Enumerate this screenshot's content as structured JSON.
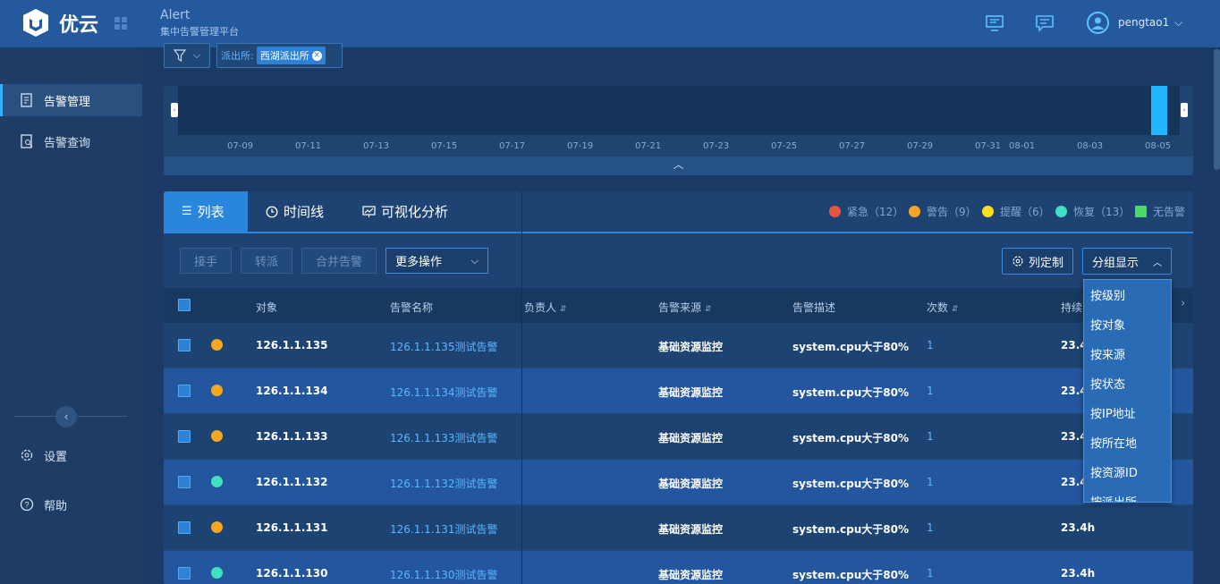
{
  "header": {
    "logo_text": "优云",
    "app_title": "Alert",
    "app_subtitle": "集中告警管理平台",
    "user_name": "pengtao1",
    "icons": [
      "monitor-icon",
      "message-icon",
      "user-icon",
      "chevron-down-icon"
    ]
  },
  "sidebar": {
    "items": [
      {
        "label": "告警管理",
        "icon": "alarm-list-icon",
        "active": true
      },
      {
        "label": "告警查询",
        "icon": "alarm-search-icon",
        "active": false
      }
    ],
    "settings_label": "设置",
    "help_label": "帮助"
  },
  "filter": {
    "key": "派出所:",
    "value": "西湖派出所"
  },
  "timeline": {
    "dates": [
      "07-09",
      "07-11",
      "07-13",
      "07-15",
      "07-17",
      "07-19",
      "07-21",
      "07-23",
      "07-25",
      "07-27",
      "07-29",
      "07-31",
      "08-01",
      "08-03",
      "08-05"
    ]
  },
  "tabs": [
    {
      "label": "列表",
      "icon": "list-icon",
      "active": true
    },
    {
      "label": "时间线",
      "icon": "clock-icon",
      "active": false
    },
    {
      "label": "可视化分析",
      "icon": "chart-icon",
      "active": false
    }
  ],
  "legend": [
    {
      "label": "紧急（12）",
      "color": "#e8553e"
    },
    {
      "label": "警告（9）",
      "color": "#f5a623"
    },
    {
      "label": "提醒（6）",
      "color": "#f5e11e"
    },
    {
      "label": "恢复（13）",
      "color": "#42e0c0"
    },
    {
      "label": "无告警",
      "color": "#4cd964"
    }
  ],
  "toolbar": {
    "accept": "接手",
    "transfer": "转派",
    "merge": "合并告警",
    "more": "更多操作",
    "column_custom": "列定制",
    "group_display": "分组显示"
  },
  "table": {
    "headers": {
      "object": "对象",
      "name": "告警名称",
      "owner": "负责人",
      "source": "告警来源",
      "desc": "告警描述",
      "count": "次数",
      "duration": "持续"
    },
    "rows": [
      {
        "object": "126.1.1.135",
        "name": "126.1.1.135测试告警",
        "source": "基础资源监控",
        "desc": "system.cpu大于80%",
        "count": "1",
        "duration": "23.4",
        "status_color": "#f5a623"
      },
      {
        "object": "126.1.1.134",
        "name": "126.1.1.134测试告警",
        "source": "基础资源监控",
        "desc": "system.cpu大于80%",
        "count": "1",
        "duration": "23.4",
        "status_color": "#f5a623"
      },
      {
        "object": "126.1.1.133",
        "name": "126.1.1.133测试告警",
        "source": "基础资源监控",
        "desc": "system.cpu大于80%",
        "count": "1",
        "duration": "23.4",
        "status_color": "#f5a623"
      },
      {
        "object": "126.1.1.132",
        "name": "126.1.1.132测试告警",
        "source": "基础资源监控",
        "desc": "system.cpu大于80%",
        "count": "1",
        "duration": "23.4",
        "status_color": "#42e0c0"
      },
      {
        "object": "126.1.1.131",
        "name": "126.1.1.131测试告警",
        "source": "基础资源监控",
        "desc": "system.cpu大于80%",
        "count": "1",
        "duration": "23.4h",
        "status_color": "#f5a623"
      },
      {
        "object": "126.1.1.130",
        "name": "126.1.1.130测试告警",
        "source": "基础资源监控",
        "desc": "system.cpu大于80%",
        "count": "1",
        "duration": "23.4h",
        "status_color": "#42e0c0"
      }
    ]
  },
  "group_dropdown": {
    "options": [
      "按级别",
      "按对象",
      "按来源",
      "按状态",
      "按IP地址",
      "按所在地",
      "按资源ID",
      "按派出所"
    ]
  }
}
